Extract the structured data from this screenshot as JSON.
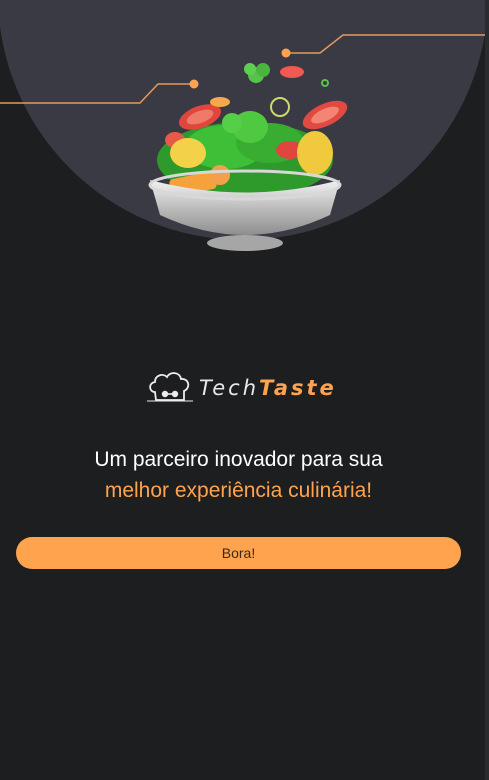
{
  "brand": {
    "name_part1": "Tech",
    "name_part2": "Taste",
    "accent_color": "#ffa34e"
  },
  "hero": {
    "image": "salad-bowl-illustration",
    "decoration": "circuit-lines"
  },
  "headline": {
    "line1": "Um parceiro inovador para sua",
    "line2": "melhor experiência culinária!"
  },
  "cta": {
    "label": "Bora!"
  },
  "colors": {
    "background": "#1d1e20",
    "circle": "#3a3a44",
    "accent": "#ffa34e"
  }
}
